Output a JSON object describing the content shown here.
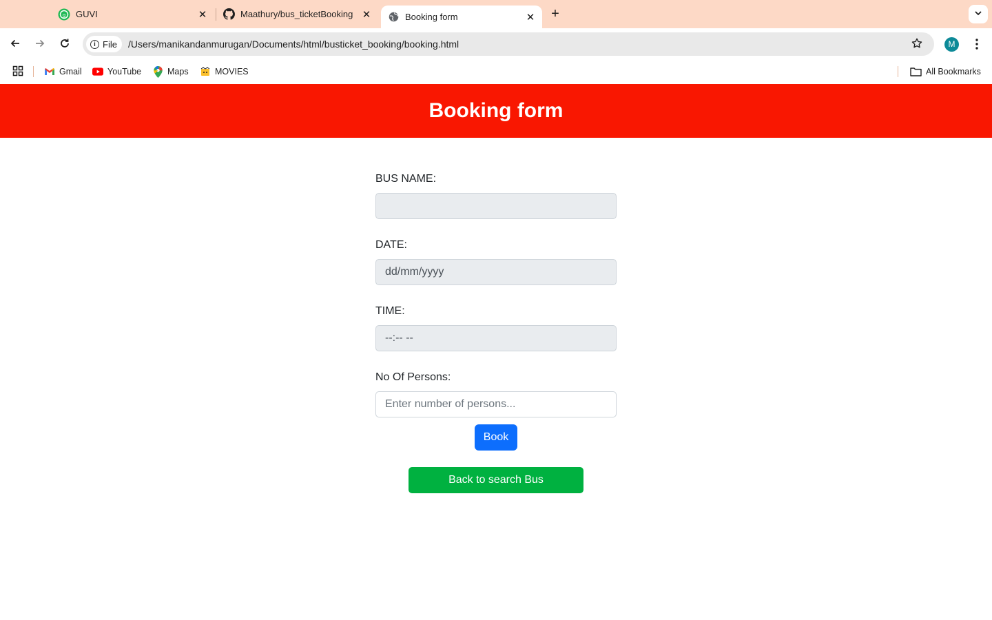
{
  "browser": {
    "tabs": [
      {
        "title": "GUVI",
        "icon": "guvi-icon",
        "active": false
      },
      {
        "title": "Maathury/bus_ticketBooking",
        "icon": "github-icon",
        "active": false
      },
      {
        "title": "Booking form",
        "icon": "globe-icon",
        "active": true
      }
    ],
    "close_glyph": "✕",
    "new_tab_glyph": "+",
    "omnibox": {
      "chip_label": "File",
      "url": "/Users/manikandanmurugan/Documents/html/busticket_booking/booking.html"
    },
    "profile_initial": "M",
    "bookmarks": [
      {
        "label": "Gmail",
        "icon": "gmail-icon"
      },
      {
        "label": "YouTube",
        "icon": "youtube-icon"
      },
      {
        "label": "Maps",
        "icon": "maps-icon"
      },
      {
        "label": "MOVIES",
        "icon": "movies-icon"
      }
    ],
    "all_bookmarks_label": "All Bookmarks"
  },
  "page": {
    "header_title": "Booking form",
    "fields": {
      "bus_name": {
        "label": "BUS NAME:",
        "value": "",
        "placeholder": ""
      },
      "date": {
        "label": "DATE:",
        "value": "dd/mm/yyyy"
      },
      "time": {
        "label": "TIME:",
        "value": "--:-- --"
      },
      "persons": {
        "label": "No Of Persons:",
        "placeholder": "Enter number of persons..."
      }
    },
    "book_label": "Book",
    "back_label": "Back to search Bus"
  },
  "colors": {
    "tabstrip": "#fdd9c6",
    "header": "#f91701",
    "book_button": "#0d6efd",
    "back_button": "#00b140"
  }
}
